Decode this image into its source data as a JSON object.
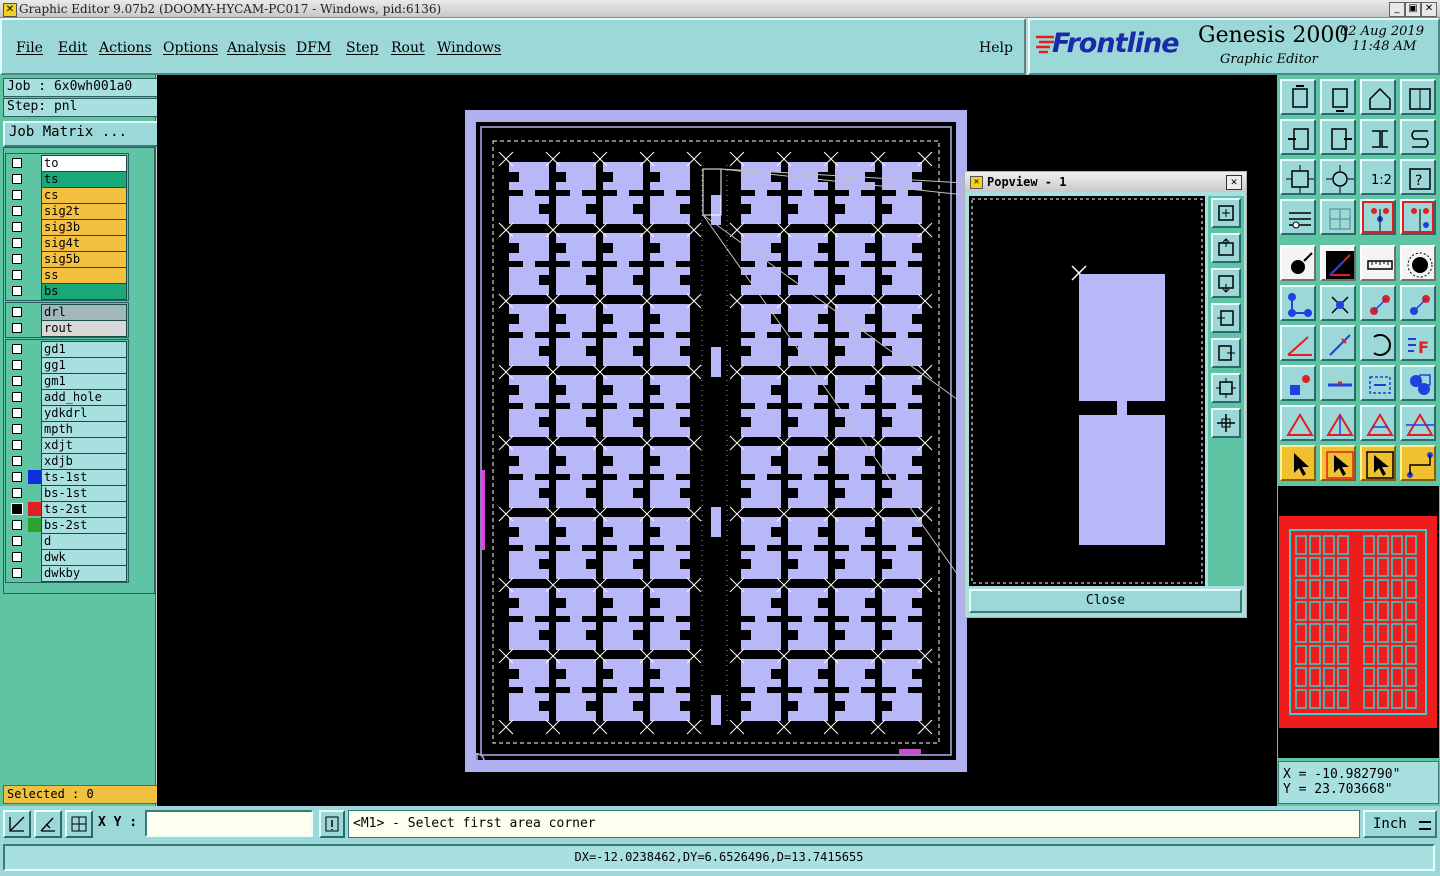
{
  "window": {
    "title": "Graphic Editor 9.07b2 (DOOMY-HYCAM-PC017 - Windows, pid:6136)",
    "icon": "x-app-icon"
  },
  "menubar": {
    "items": [
      "File",
      "Edit",
      "Actions",
      "Options",
      "Analysis",
      "DFM",
      "Step",
      "Rout",
      "Windows"
    ],
    "help": "Help"
  },
  "brand": {
    "logo": "Frontline",
    "product": "Genesis 2000",
    "subtitle": "Graphic Editor",
    "date": "02 Aug 2019",
    "time": "11:48 AM"
  },
  "job": {
    "job_label": "Job : 6x0wh001a0",
    "step_label": "Step: pnl",
    "matrix_button": "Job Matrix ..."
  },
  "layers": {
    "group1": [
      {
        "name": "to",
        "color": "#ffffff"
      },
      {
        "name": "ts",
        "color": "#1aa878"
      },
      {
        "name": "cs",
        "color": "#f4c040"
      },
      {
        "name": "sig2t",
        "color": "#f4c040"
      },
      {
        "name": "sig3b",
        "color": "#f4c040"
      },
      {
        "name": "sig4t",
        "color": "#f4c040"
      },
      {
        "name": "sig5b",
        "color": "#f4c040"
      },
      {
        "name": "ss",
        "color": "#f4c040"
      },
      {
        "name": "bs",
        "color": "#1aa878"
      }
    ],
    "group2": [
      {
        "name": "drl",
        "color": "#a0b8b8"
      },
      {
        "name": "rout",
        "color": "#d8d8d8"
      }
    ],
    "group3": [
      {
        "name": "gd1",
        "swatch": ""
      },
      {
        "name": "gg1",
        "swatch": ""
      },
      {
        "name": "gm1",
        "swatch": ""
      },
      {
        "name": "add_hole",
        "swatch": ""
      },
      {
        "name": "ydkdrl",
        "swatch": ""
      },
      {
        "name": "mpth",
        "swatch": ""
      },
      {
        "name": "xdjt",
        "swatch": ""
      },
      {
        "name": "xdjb",
        "swatch": ""
      },
      {
        "name": "ts-1st",
        "swatch": "#1030e0"
      },
      {
        "name": "bs-1st",
        "swatch": ""
      },
      {
        "name": "ts-2st",
        "swatch": "#e02020"
      },
      {
        "name": "bs-2st",
        "swatch": "#30a030"
      },
      {
        "name": "d",
        "swatch": ""
      },
      {
        "name": "dwk",
        "swatch": ""
      },
      {
        "name": "dwkby",
        "swatch": ""
      }
    ],
    "selected_label": "Selected : 0"
  },
  "popview": {
    "title": "Popview - 1",
    "close_button": "Close"
  },
  "coords": {
    "x_label": "X = -10.982790\"",
    "y_label": "Y = 23.703668\""
  },
  "cmdbar": {
    "xy_label": "X Y :",
    "xy_value": "",
    "prompt": "<M1> - Select first area corner",
    "unit": "Inch"
  },
  "status": {
    "measure": "DX=-12.0238462,DY=6.6526496,D=13.7415655"
  },
  "colors": {
    "panel_teal": "#5ec4a4",
    "button_cyan": "#9cd8d8",
    "pad_lavender": "#b8b8f8",
    "board_outline": "#b0b0f0",
    "selected_yellow": "#f0c040",
    "minimap_red": "#ee1c1c",
    "minimap_cyan": "#30d0d0"
  }
}
